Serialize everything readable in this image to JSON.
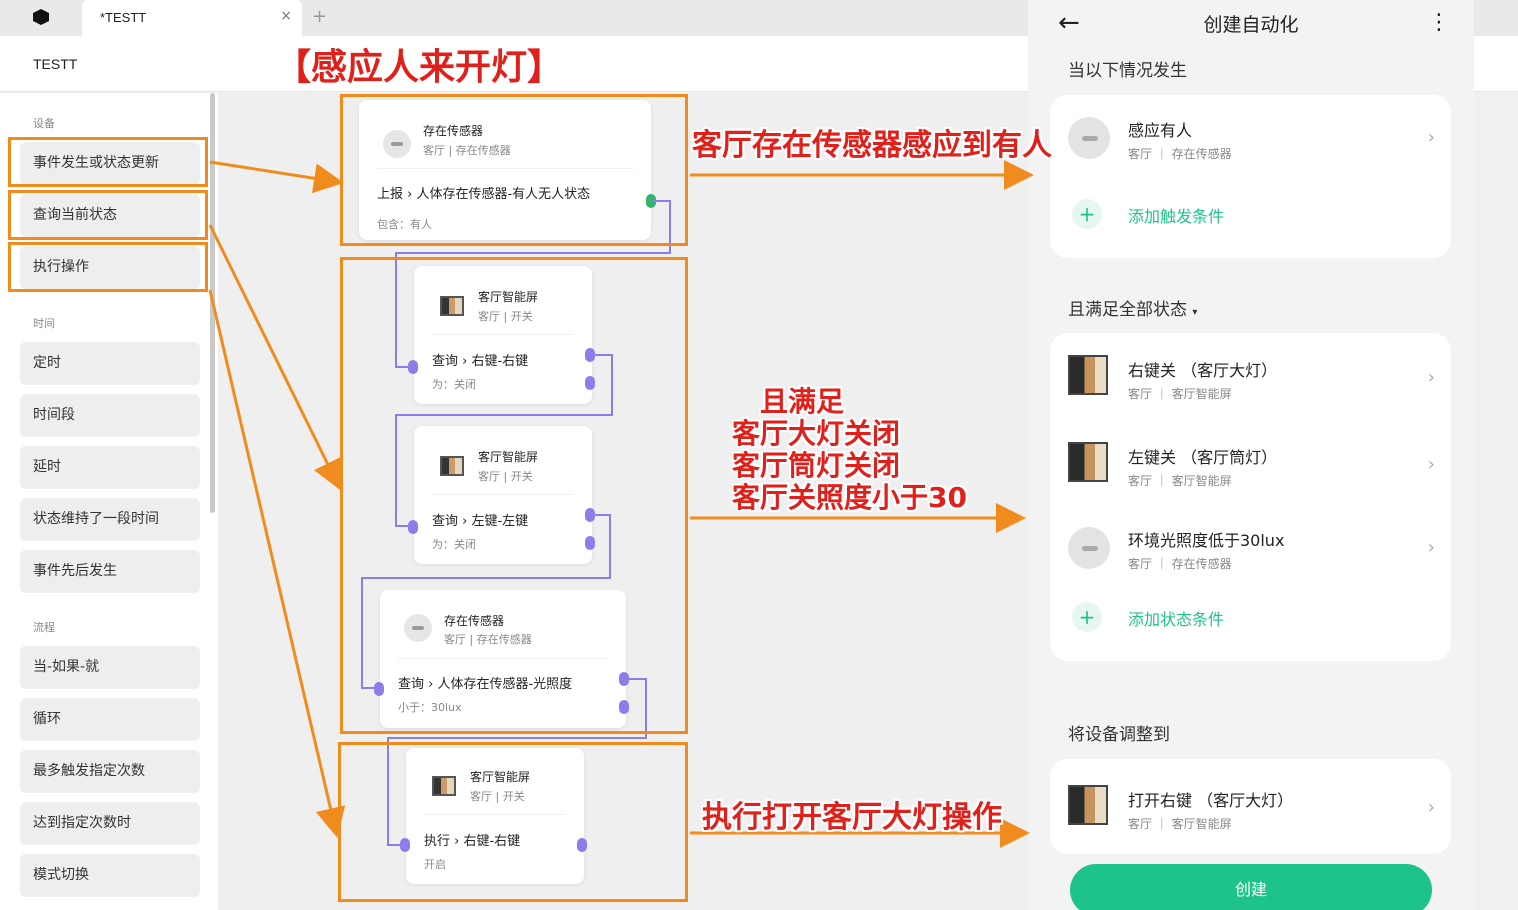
{
  "tab": {
    "title": "*TESTT",
    "close": "×",
    "add": "+"
  },
  "project": {
    "name": "TESTT"
  },
  "sidebar": {
    "sections": {
      "device": "设备",
      "time": "时间",
      "flow": "流程"
    },
    "device_items": [
      "事件发生或状态更新",
      "查询当前状态",
      "执行操作"
    ],
    "time_items": [
      "定时",
      "时间段",
      "延时",
      "状态维持了一段时间",
      "事件先后发生"
    ],
    "flow_items": [
      "当-如果-就",
      "循环",
      "最多触发指定次数",
      "达到指定次数时",
      "模式切换"
    ]
  },
  "nodes": {
    "n1": {
      "title": "存在传感器",
      "sub": "客厅 | 存在传感器",
      "action": "上报 › 人体存在传感器-有人无人状态",
      "value": "包含：有人"
    },
    "n2": {
      "title": "客厅智能屏",
      "sub": "客厅 | 开关",
      "action": "查询 › 右键-右键",
      "value": "为：关闭"
    },
    "n3": {
      "title": "客厅智能屏",
      "sub": "客厅 | 开关",
      "action": "查询 › 左键-左键",
      "value": "为：关闭"
    },
    "n4": {
      "title": "存在传感器",
      "sub": "客厅 | 存在传感器",
      "action": "查询 › 人体存在传感器-光照度",
      "value": "小于：30lux"
    },
    "n5": {
      "title": "客厅智能屏",
      "sub": "客厅 | 开关",
      "action": "执行 › 右键-右键",
      "value": "开启"
    }
  },
  "annotations": {
    "title": "【感应人来开灯】",
    "trigger": "客厅存在传感器感应到有人",
    "cond1": "且满足",
    "cond2": "客厅大灯关闭",
    "cond3": "客厅筒灯关闭",
    "cond4": "客厅关照度小于30",
    "action": "执行打开客厅大灯操作"
  },
  "phone": {
    "title": "创建自动化",
    "back": "←",
    "more": "⋮",
    "sec_when": "当以下情况发生",
    "sec_and": "且满足全部状态",
    "sec_do": "将设备调整到",
    "trigger_row": {
      "title": "感应有人",
      "room": "客厅",
      "device": "存在传感器"
    },
    "add_trigger": "添加触发条件",
    "cond_rows": [
      {
        "title": "右键关 （客厅大灯）",
        "room": "客厅",
        "device": "客厅智能屏"
      },
      {
        "title": "左键关 （客厅筒灯）",
        "room": "客厅",
        "device": "客厅智能屏"
      },
      {
        "title": "环境光照度低于30lux",
        "room": "客厅",
        "device": "存在传感器"
      }
    ],
    "add_cond": "添加状态条件",
    "action_row": {
      "title": "打开右键 （客厅大灯）",
      "room": "客厅",
      "device": "客厅智能屏"
    },
    "create": "创建"
  },
  "colors": {
    "accent": "#1ec38a",
    "annotation_box": "#f08c1e",
    "annotation_text": "#e0201a",
    "port": "#8b7ee8"
  }
}
